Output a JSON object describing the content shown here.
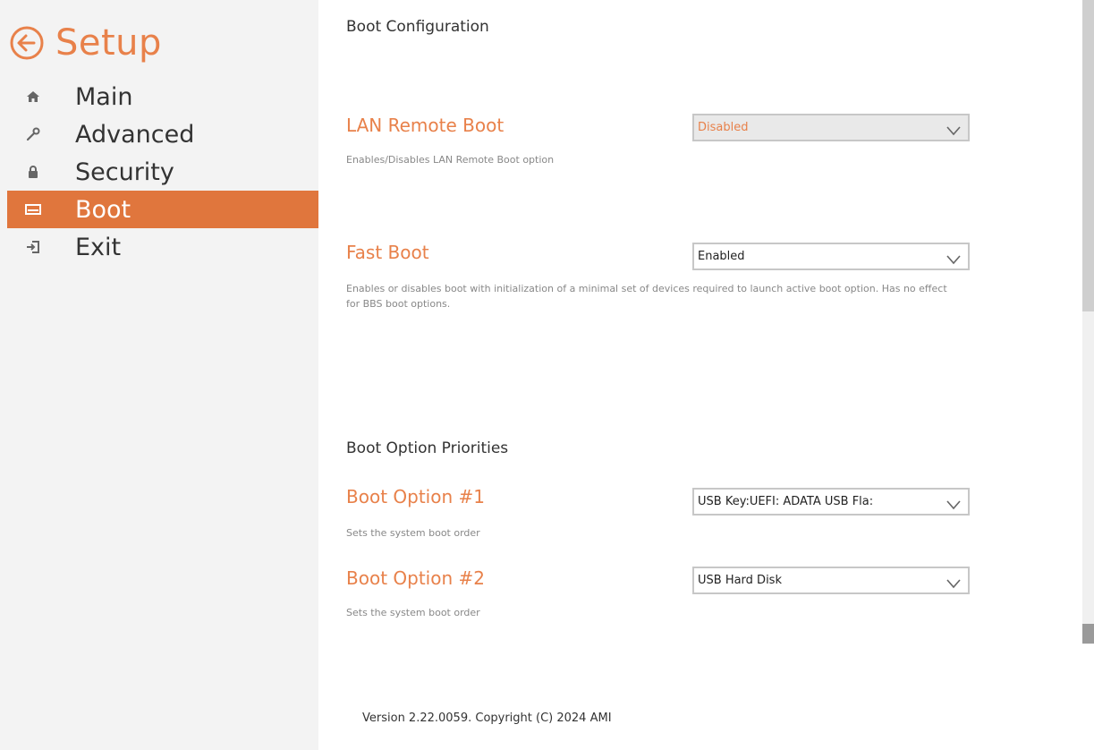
{
  "sidebar": {
    "title": "Setup",
    "items": [
      {
        "label": "Main",
        "icon": "home-icon"
      },
      {
        "label": "Advanced",
        "icon": "wrench-icon"
      },
      {
        "label": "Security",
        "icon": "lock-icon"
      },
      {
        "label": "Boot",
        "icon": "drive-icon",
        "active": true
      },
      {
        "label": "Exit",
        "icon": "exit-icon"
      }
    ]
  },
  "main": {
    "boot_config_title": "Boot Configuration",
    "lan_remote_boot": {
      "title": "LAN Remote Boot",
      "value": "Disabled",
      "description": "Enables/Disables LAN Remote Boot option"
    },
    "fast_boot": {
      "title": "Fast Boot",
      "value": "Enabled",
      "description": "Enables or disables boot with initialization of a minimal set of devices required to launch active boot option. Has no effect for BBS boot options."
    },
    "priorities_title": "Boot Option Priorities",
    "boot_option_1": {
      "title": "Boot Option #1",
      "value": "USB Key:UEFI: ADATA USB Fla:",
      "description": "Sets the system boot order"
    },
    "boot_option_2": {
      "title": "Boot Option #2",
      "value": "USB Hard Disk",
      "description": "Sets the system boot order"
    }
  },
  "footer": {
    "version": "Version 2.22.0059. Copyright (C) 2024 AMI"
  },
  "colors": {
    "accent": "#e8814a",
    "active_bg": "#e0763d",
    "sidebar_bg": "#f3f3f3"
  }
}
